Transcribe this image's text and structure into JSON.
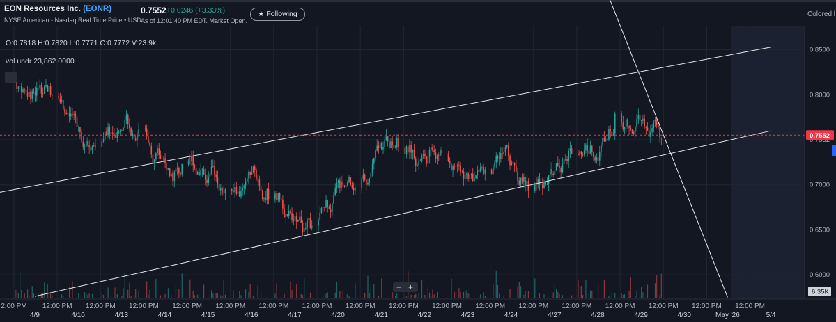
{
  "header": {
    "company_name": "EON Resources Inc.",
    "ticker": "(EONR)",
    "exchange_line": "NYSE American - Nasdaq Real Time Price • USD",
    "price": "0.7552",
    "change": "+0.0246 (+3.33%)",
    "as_of": "As of 12:01:40 PM EDT. Market Open.",
    "follow_label": "★ Following",
    "colored_label": "Colored l"
  },
  "legend": {
    "ohlc": "O:0.7818  H:0.7820  L:0.7771  C:0.7772  V:23.9k",
    "volume_label": "vol undr  23,862.0000"
  },
  "zoom": {
    "minus": "−",
    "plus": "+"
  },
  "colors": {
    "up": "#26a69a",
    "down": "#ef5350",
    "background": "#131722",
    "price_tag": "#f23645",
    "grid": "#232631"
  },
  "chart_data": {
    "type": "candlestick",
    "title": "",
    "y_ticks": [
      "0.8500",
      "0.8000",
      "0.7552",
      "0.7000",
      "0.6500",
      "0.6000"
    ],
    "y_tick_values": [
      0.85,
      0.8,
      0.75,
      0.7,
      0.65,
      0.6
    ],
    "ylim": [
      0.573,
      0.876
    ],
    "current_price": 0.7552,
    "current_price_label": "0.7552",
    "volume_max_label": "6.35K",
    "x_tick_labels": [
      "2:00 PM",
      "12:00 PM",
      "12:00 PM",
      "12:00 PM",
      "12:00 PM",
      "12:00 PM",
      "12:00 PM",
      "12:00 PM",
      "12:00 PM",
      "12:00 PM",
      "12:00 PM",
      "12:00 PM",
      "12:00 PM",
      "12:00 PM",
      "12:00 PM",
      "12:00 PM",
      "12:00 PM",
      "12:00 PM"
    ],
    "date_labels": [
      "4/9",
      "4/10",
      "4/13",
      "4/14",
      "4/15",
      "4/16",
      "4/17",
      "4/20",
      "4/21",
      "4/22",
      "4/23",
      "4/24",
      "4/27",
      "4/28",
      "4/29",
      "4/30",
      "May '26",
      "5/4"
    ],
    "sessions": [
      "4/9",
      "4/10",
      "4/13",
      "4/14",
      "4/15",
      "4/16",
      "4/17",
      "4/20",
      "4/21",
      "4/22",
      "4/23",
      "4/24",
      "4/27",
      "4/28",
      "4/29"
    ],
    "session_close": [
      0.805,
      0.735,
      0.765,
      0.715,
      0.7,
      0.692,
      0.65,
      0.688,
      0.745,
      0.735,
      0.712,
      0.702,
      0.74,
      0.77,
      0.755
    ],
    "trend_lines": [
      {
        "from": [
          "4/9",
          0.576
        ],
        "to": [
          "5/4",
          0.76
        ]
      },
      {
        "from": [
          "4/8",
          0.69
        ],
        "to": [
          "5/4",
          0.853
        ]
      },
      {
        "from": [
          "4/28",
          0.94
        ],
        "to": [
          "May '26",
          0.575
        ]
      }
    ]
  }
}
